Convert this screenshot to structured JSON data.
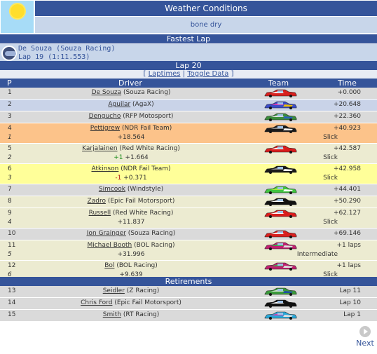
{
  "weather": {
    "title": "Weather Conditions",
    "value": "bone dry",
    "icon": "sun-icon"
  },
  "fastest_lap": {
    "title": "Fastest Lap",
    "driver": "De Souza (Souza Racing)",
    "lap": "Lap 19 (1:11.553)"
  },
  "lap_header": "Lap 20",
  "links": {
    "laptimes": "Laptimes",
    "toggle": "Toggle Data",
    "open": "[",
    "sep": "|",
    "close": "]"
  },
  "columns": {
    "pos": "P",
    "driver": "Driver",
    "team": "Team",
    "time": "Time"
  },
  "rows": [
    {
      "pos": "1",
      "name": "De Souza",
      "team": "(Souza Racing)",
      "time": "+0.000",
      "bg": "#dadada",
      "car": [
        "#d8201f",
        "#ffffff",
        "#d8201f"
      ]
    },
    {
      "pos": "2",
      "name": "Aguilar",
      "team": "(AgaX)",
      "time": "+20.648",
      "bg": "#c9d3e8",
      "car": [
        "#3a4cc8",
        "#d83bb0",
        "#f0c000"
      ]
    },
    {
      "pos": "3",
      "name": "Dengucho",
      "team": "(RFP Motosport)",
      "time": "+22.360",
      "bg": "#dadada",
      "car": [
        "#3c8d3c",
        "#e0e0e0",
        "#2a60c0"
      ]
    },
    {
      "pos": "4",
      "name": "Pettigrew",
      "team": "(NDR Fail Team)",
      "time": "+40.923",
      "sub_pos": "1",
      "gap": "+18.564",
      "tyre": "Slick",
      "bg": "#fcc38a",
      "car": [
        "#1a1a1a",
        "#8a8a8a",
        "#f0f0f0"
      ]
    },
    {
      "pos": "5",
      "name": "Karjalainen",
      "team": "(Red White Racing)",
      "time": "+42.587",
      "sub_pos": "2",
      "gap_up": "+1",
      "gap": "+1.664",
      "tyre": "Slick",
      "bg": "#ecebd1",
      "car": [
        "#d81c1c",
        "#ffffff",
        "#d81c1c"
      ]
    },
    {
      "pos": "6",
      "name": "Atkinson",
      "team": "(NDR Fail Team)",
      "time": "+42.958",
      "sub_pos": "3",
      "gap_up": "-1",
      "gap": "+0.371",
      "tyre": "Slick",
      "bg": "#ffff99",
      "car": [
        "#1a1a1a",
        "#8a8a8a",
        "#f0f0f0"
      ]
    },
    {
      "pos": "7",
      "name": "Simcook",
      "team": "(Windstyle)",
      "time": "+44.401",
      "bg": "#dadada",
      "car": [
        "#3fc43f",
        "#a8e83f",
        "#ffffff"
      ]
    },
    {
      "pos": "8",
      "name": "Zadro",
      "team": "(Epic Fail Motorsport)",
      "time": "+50.290",
      "bg": "#ecebd1",
      "car": [
        "#111111",
        "#ffffff",
        "#111111"
      ]
    },
    {
      "pos": "9",
      "name": "Russell",
      "team": "(Red White Racing)",
      "time": "+62.127",
      "sub_pos": "4",
      "gap": "+11.837",
      "tyre": "Slick",
      "bg": "#ecebd1",
      "car": [
        "#d81c1c",
        "#ffffff",
        "#d81c1c"
      ]
    },
    {
      "pos": "10",
      "name": "Jon Grainger",
      "team": "(Souza Racing)",
      "time": "+69.146",
      "bg": "#dadada",
      "car": [
        "#d8201f",
        "#ffffff",
        "#d8201f"
      ]
    },
    {
      "pos": "11",
      "name": "Michael Booth",
      "team": "(BOL Racing)",
      "time": "+1 laps",
      "sub_pos": "5",
      "gap": "+31.996",
      "tyre": "Intermediate",
      "bg": "#ecebd1",
      "car": [
        "#c02070",
        "#3aa84a",
        "#e0e0e0"
      ]
    },
    {
      "pos": "12",
      "name": "Bol",
      "team": "(BOL Racing)",
      "time": "+1 laps",
      "sub_pos": "6",
      "gap": "+9.639",
      "tyre": "Slick",
      "bg": "#ecebd1",
      "car": [
        "#c02070",
        "#3aa84a",
        "#e0e0e0"
      ]
    }
  ],
  "retirements_title": "Retirements",
  "retirements": [
    {
      "pos": "13",
      "name": "Seidler",
      "team": "(Z Racing)",
      "time": "Lap 11",
      "bg": "#dadada",
      "car": [
        "#3c9a3c",
        "#d0e0d0",
        "#1e50a0"
      ]
    },
    {
      "pos": "14",
      "name": "Chris Ford",
      "team": "(Epic Fail Motorsport)",
      "time": "Lap 10",
      "bg": "#dadada",
      "car": [
        "#111111",
        "#ffffff",
        "#111111"
      ]
    },
    {
      "pos": "15",
      "name": "Smith",
      "team": "(RT Racing)",
      "time": "Lap 1",
      "bg": "#dadada",
      "car": [
        "#2aa8d8",
        "#d83bb0",
        "#e0e0e0"
      ]
    }
  ],
  "next": {
    "label": "Next",
    "icon": "next-arrow-icon"
  }
}
